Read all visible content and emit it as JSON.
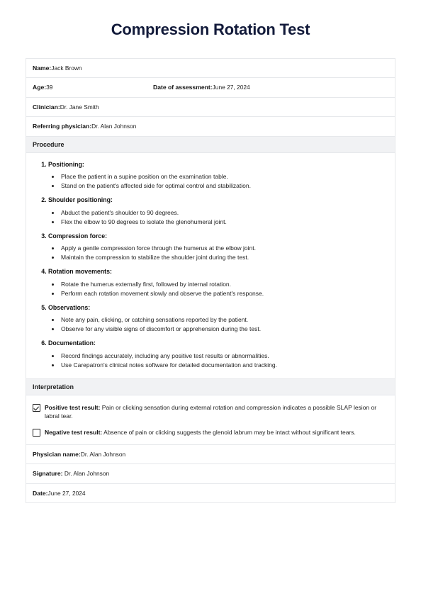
{
  "document": {
    "title": "Compression Rotation Test"
  },
  "patient_info": {
    "name_label": "Name:",
    "name_value": "Jack Brown",
    "age_label": "Age:",
    "age_value": "39",
    "date_of_assessment_label": "Date of assessment:",
    "date_of_assessment_value": "June 27, 2024",
    "clinician_label": "Clinician:",
    "clinician_value": "Dr. Jane Smith",
    "referring_physician_label": "Referring physician:",
    "referring_physician_value": "Dr. Alan Johnson"
  },
  "procedure": {
    "header": "Procedure",
    "steps": [
      {
        "title": "Positioning:",
        "bullets": [
          "Place the patient in a supine position on the examination table.",
          "Stand on the patient's affected side for optimal control and stabilization."
        ]
      },
      {
        "title": "Shoulder positioning:",
        "bullets": [
          "Abduct the patient's shoulder to 90 degrees.",
          "Flex the elbow to 90 degrees to isolate the glenohumeral joint."
        ]
      },
      {
        "title": "Compression force:",
        "bullets": [
          "Apply a gentle compression force through the humerus at the elbow joint.",
          "Maintain the compression to stabilize the shoulder joint during the test."
        ]
      },
      {
        "title": "Rotation movements:",
        "bullets": [
          "Rotate the humerus externally first, followed by internal rotation.",
          "Perform each rotation movement slowly and observe the patient's response."
        ]
      },
      {
        "title": "Observations:",
        "bullets": [
          "Note any pain, clicking, or catching sensations reported by the patient.",
          "Observe for any visible signs of discomfort or apprehension during the test."
        ]
      },
      {
        "title": "Documentation:",
        "bullets": [
          "Record findings accurately, including any positive test results or abnormalities.",
          "Use Carepatron's clinical notes software for detailed documentation and tracking."
        ]
      }
    ]
  },
  "interpretation": {
    "header": "Interpretation",
    "options": [
      {
        "label": "Positive test result:",
        "text": " Pain or clicking sensation during external rotation and compression indicates a possible SLAP lesion or labral tear.",
        "checked": true
      },
      {
        "label": "Negative test result:",
        "text": " Absence of pain or clicking suggests the glenoid labrum may be intact without significant tears.",
        "checked": false
      }
    ]
  },
  "signoff": {
    "physician_name_label": "Physician name:",
    "physician_name_value": "Dr. Alan Johnson",
    "signature_label": "Signature:",
    "signature_value": " Dr. Alan Johnson",
    "date_label": "Date:",
    "date_value": "June 27, 2024"
  },
  "colors": {
    "title": "#121a3a",
    "section_header_bg": "#f1f2f4",
    "border": "#e6e8eb",
    "text": "#222222"
  }
}
